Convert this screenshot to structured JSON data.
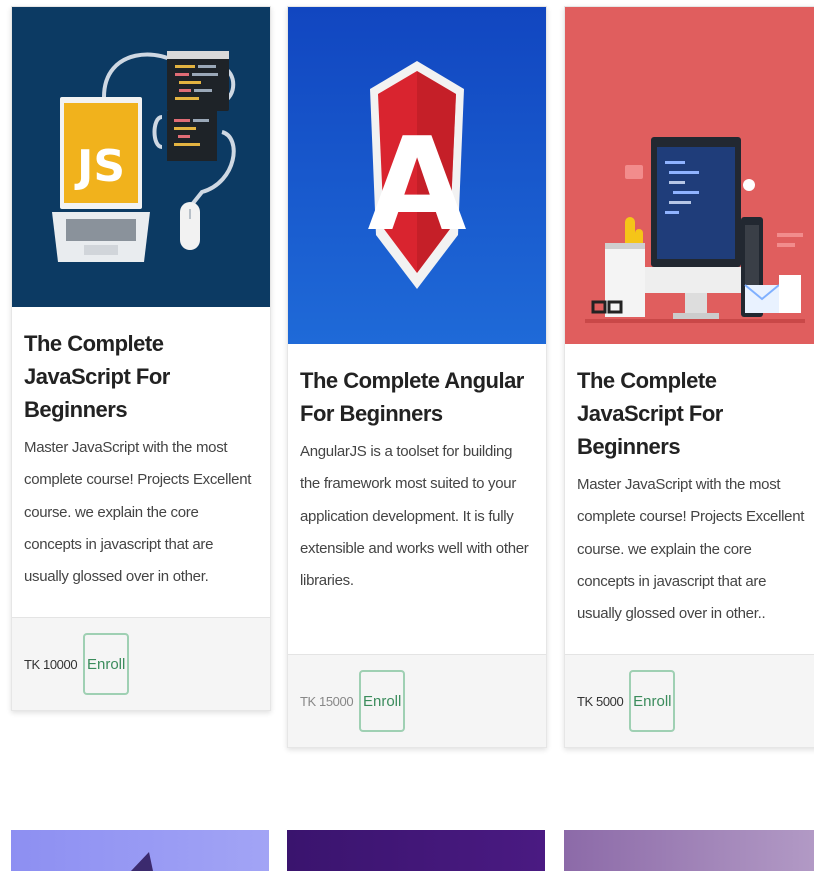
{
  "cards": [
    {
      "title": "The Complete JavaScript For Beginners",
      "description": "Master JavaScript with the most complete course! Projects Excellent course. we explain the core concepts in javascript that are usually glossed over in other.",
      "price": "TK 10000",
      "enroll_label": "Enroll",
      "image_text": "JS",
      "image_bg": "#0c3a63"
    },
    {
      "title": "The Complete Angular For Beginners",
      "description": "AngularJS is a toolset for building the framework most suited to your application development. It is fully extensible and works well with other libraries.",
      "price": "TK 15000",
      "enroll_label": "Enroll",
      "image_text": "A",
      "image_bg": "#1a56c4"
    },
    {
      "title": "The Complete JavaScript For Beginners",
      "description": "Master JavaScript with the most complete course! Projects Excellent course. we explain the core concepts in javascript that are usually glossed over in other..",
      "price": "TK 5000",
      "enroll_label": "Enroll",
      "image_bg": "#e05e5e"
    }
  ],
  "teasers": [
    {
      "image_bg": "#8a8cf0"
    },
    {
      "image_bg": "#3b1470"
    },
    {
      "image_bg": "#9c7cb0"
    }
  ]
}
